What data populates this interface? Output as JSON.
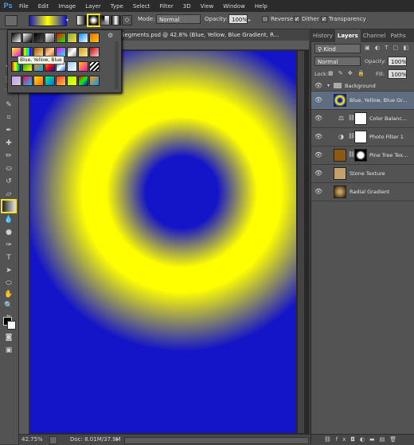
{
  "app": {
    "logo": "Ps"
  },
  "menu": [
    "File",
    "Edit",
    "Image",
    "Layer",
    "Type",
    "Select",
    "Filter",
    "3D",
    "View",
    "Window",
    "Help"
  ],
  "options": {
    "mode_label": "Mode:",
    "mode_value": "Normal",
    "opacity_label": "Opacity:",
    "opacity_value": "100%",
    "reverse_label": "Reverse",
    "dither_label": "Dither",
    "transparency_label": "Transparency",
    "reverse_checked": false,
    "dither_checked": true,
    "transparency_checked": true
  },
  "picker": {
    "tooltip": "Blue, Yellow, Blue"
  },
  "document": {
    "tab_title": "Segments.psd @ 42.8% (Blue, Yellow, Blue Gradient, R...",
    "zoom": "42.75%",
    "doc_size": "Doc: 8.01M/37.9M"
  },
  "panel": {
    "tabs": [
      "History",
      "Layers",
      "Channel",
      "Paths"
    ],
    "active_tab": "Layers",
    "filter_kind": "Kind",
    "blend_mode": "Normal",
    "opacity_label": "Opacity:",
    "opacity_value": "100%",
    "lock_label": "Lock:",
    "fill_label": "Fill:",
    "fill_value": "100%"
  },
  "layers": [
    {
      "name": "Background",
      "group": true
    },
    {
      "name": "Blue, Yellow, Blue Gr..."
    },
    {
      "name": "Color Balanc..."
    },
    {
      "name": "Photo Filter 1"
    },
    {
      "name": "Pine Tree Tex..."
    },
    {
      "name": "Stone Texture"
    },
    {
      "name": "Radial Gradient"
    }
  ],
  "colors": {
    "gradient_blue": "#1414c8",
    "gradient_yellow": "#ffff00",
    "highlight": "#f4e21a"
  }
}
